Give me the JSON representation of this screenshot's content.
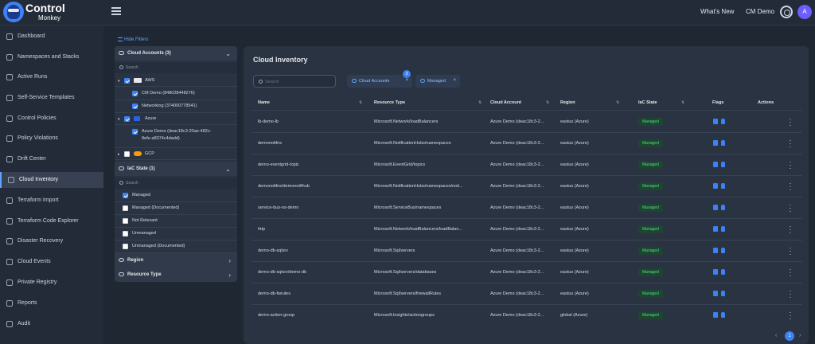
{
  "brand": {
    "line1": "Control",
    "line2": "Monkey"
  },
  "topbar": {
    "whats_new": "What's New",
    "account": "CM Demo",
    "avatar_initial": "A"
  },
  "sidebar": {
    "items": [
      {
        "label": "Dashboard",
        "icon": "dashboard-icon"
      },
      {
        "label": "Namespaces and Stacks",
        "icon": "stack-icon"
      },
      {
        "label": "Active Runs",
        "icon": "run-icon"
      },
      {
        "label": "Self-Service Templates",
        "icon": "template-icon"
      },
      {
        "label": "Control Policies",
        "icon": "policy-icon"
      },
      {
        "label": "Policy Violations",
        "icon": "violation-icon"
      },
      {
        "label": "Drift Center",
        "icon": "drift-icon"
      },
      {
        "label": "Cloud Inventory",
        "icon": "cloud-icon",
        "active": true
      },
      {
        "label": "Terraform Import",
        "icon": "import-icon"
      },
      {
        "label": "Terraform Code Explorer",
        "icon": "code-icon"
      },
      {
        "label": "Disaster Recovery",
        "icon": "recovery-icon"
      },
      {
        "label": "Cloud Events",
        "icon": "events-icon"
      },
      {
        "label": "Private Registry",
        "icon": "registry-icon"
      },
      {
        "label": "Reports",
        "icon": "reports-icon"
      },
      {
        "label": "Audit",
        "icon": "audit-icon"
      }
    ]
  },
  "filters": {
    "hide_label": "Hide Filters",
    "cloud_accounts": {
      "title": "Cloud Accounts (3)",
      "search_placeholder": "Search",
      "aws": "AWS",
      "aws_accounts": [
        "CM Demo (848028448276)",
        "Networking (374000778541)"
      ],
      "azure": "Azure",
      "azure_account_line1": "Azure Demo (deac18c3-20ae-482c-",
      "azure_account_line2": "8efe-a8374c4dadd)",
      "gcp": "GCP"
    },
    "iac_state": {
      "title": "IaC State (1)",
      "search_placeholder": "Search",
      "options": [
        "Managed",
        "Managed (Documented)",
        "Not Relevant",
        "Unmanaged",
        "Unmanaged (Documented)"
      ]
    },
    "region": {
      "title": "Region"
    },
    "resource_type": {
      "title": "Resource Type"
    }
  },
  "main": {
    "title": "Cloud Inventory",
    "search_placeholder": "Search",
    "chips": [
      {
        "label": "Cloud Accounts",
        "count": "3"
      },
      {
        "label": "Managed"
      }
    ],
    "columns": [
      "Name",
      "Resource Type",
      "Cloud Account",
      "Region",
      "IaC State",
      "Flags",
      "Actions"
    ],
    "rows": [
      {
        "name": "lb-demo-lb",
        "type": "Microsoft.Network/loadBalancers",
        "account": "Azure Demo (deac18c3-2...",
        "region": "eastus (Azure)",
        "state": "Managed"
      },
      {
        "name": "demonotifns",
        "type": "Microsoft.NotificationHubs/namespaces",
        "account": "Azure Demo (deac18c3-2...",
        "region": "eastus (Azure)",
        "state": "Managed"
      },
      {
        "name": "demo-eventgrid-topic",
        "type": "Microsoft.EventGrid/topics",
        "account": "Azure Demo (deac18c3-2...",
        "region": "eastus (Azure)",
        "state": "Managed"
      },
      {
        "name": "demonotifns/demonotifhub",
        "type": "Microsoft.NotificationHubs/namespaces/noti...",
        "account": "Azure Demo (deac18c3-2...",
        "region": "eastus (Azure)",
        "state": "Managed"
      },
      {
        "name": "service-bus-ns-demo",
        "type": "Microsoft.ServiceBus/namespaces",
        "account": "Azure Demo (deac18c3-2...",
        "region": "eastus (Azure)",
        "state": "Managed"
      },
      {
        "name": "http",
        "type": "Microsoft.Network/loadBalancers/loadBalan...",
        "account": "Azure Demo (deac18c3-2...",
        "region": "eastus (Azure)",
        "state": "Managed"
      },
      {
        "name": "demo-db-sqlsrv",
        "type": "Microsoft.Sql/servers",
        "account": "Azure Demo (deac18c3-2...",
        "region": "eastus (Azure)",
        "state": "Managed"
      },
      {
        "name": "demo-db-sqlsrv/demo-db",
        "type": "Microsoft.Sql/servers/databases",
        "account": "Azure Demo (deac18c3-2...",
        "region": "eastus (Azure)",
        "state": "Managed"
      },
      {
        "name": "demo-db-fwrules",
        "type": "Microsoft.Sql/servers/firewallRules",
        "account": "Azure Demo (deac18c3-2...",
        "region": "eastus (Azure)",
        "state": "Managed"
      },
      {
        "name": "demo-action-group",
        "type": "Microsoft.Insights/actiongroups",
        "account": "Azure Demo (deac18c3-2...",
        "region": "global (Azure)",
        "state": "Managed"
      }
    ],
    "pagination": {
      "current": "1"
    }
  },
  "colors": {
    "accent": "#3b82f6",
    "managed_text": "#4ade80",
    "managed_bg": "#1f4432",
    "bg": "#1f2733",
    "panel": "#2a3342"
  }
}
